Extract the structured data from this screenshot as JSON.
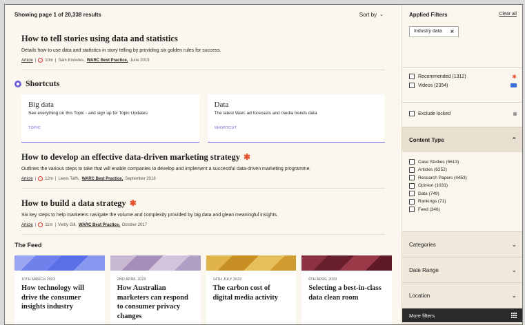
{
  "results_text": "Showing page 1 of 20,338 results",
  "sort_label": "Sort by",
  "articles": [
    {
      "title": "How to tell stories using data and statistics",
      "desc": "Details how to use data and statistics in story telling by providing six golden rules for success.",
      "type": "Article",
      "read_time": "10m",
      "author": "Sam Knowles,",
      "publication": "WARC Best Practice,",
      "date": "June 2019",
      "starred": false
    }
  ],
  "shortcuts": {
    "heading": "Shortcuts",
    "cards": [
      {
        "title": "Big data",
        "desc": "See everything on this Topic - and sign up for Topic Updates",
        "tag": "TOPIC"
      },
      {
        "title": "Data",
        "desc": "The latest Warc ad forecasts and media trends data",
        "tag": "SHORTCUT"
      }
    ]
  },
  "articles2": [
    {
      "title": "How to develop an effective data-driven marketing strategy",
      "desc": "Outlines the various steps to take that will enable companies to develop and implement a successful data-driven marketing programme.",
      "type": "Article",
      "read_time": "12m",
      "author": "Lewis Taffs,",
      "publication": "WARC Best Practice,",
      "date": "September 2018",
      "starred": true
    },
    {
      "title": "How to build a data strategy",
      "desc": "Six key steps to help marketers navigate the volume and complexity provided by big data and glean meaningful insights.",
      "type": "Article",
      "read_time": "11m",
      "author": "Verity Gill,",
      "publication": "WARC Best Practice,",
      "date": "October 2017",
      "starred": true
    }
  ],
  "feed": {
    "heading": "The Feed",
    "items": [
      {
        "date": "10TH MARCH 2023",
        "title": "How technology will drive the consumer insights industry",
        "color": "#7b8cf0"
      },
      {
        "date": "2ND APRIL 2023",
        "title": "How Australian marketers can respond to consumer privacy changes",
        "color": "#b9a3c8"
      },
      {
        "date": "14TH JULY 2022",
        "title": "The carbon cost of digital media activity",
        "color": "#d9a236"
      },
      {
        "date": "6TH APRIL 2023",
        "title": "Selecting a best-in-class data clean room",
        "color": "#7a2a36"
      }
    ]
  },
  "sidebar": {
    "applied_filters": "Applied Filters",
    "clear_all": "Clear all",
    "chip_label": "Industry data",
    "chip_remove": "✕",
    "recommended": "Recommended (1312)",
    "videos": "Videos (2354)",
    "exclude_locked": "Exclude locked",
    "content_type": "Content Type",
    "content_types": [
      "Case Studies (5613)",
      "Articles (6252)",
      "Research Papers (4453)",
      "Opinion (1031)",
      "Data (749)",
      "Rankings (71)",
      "Feed (346)"
    ],
    "categories": "Categories",
    "date_range": "Date Range",
    "location": "Location",
    "more_filters": "More filters"
  },
  "colors": {
    "accent": "#6c5fd6",
    "star": "#e8512a",
    "clock": "#d9362b"
  }
}
